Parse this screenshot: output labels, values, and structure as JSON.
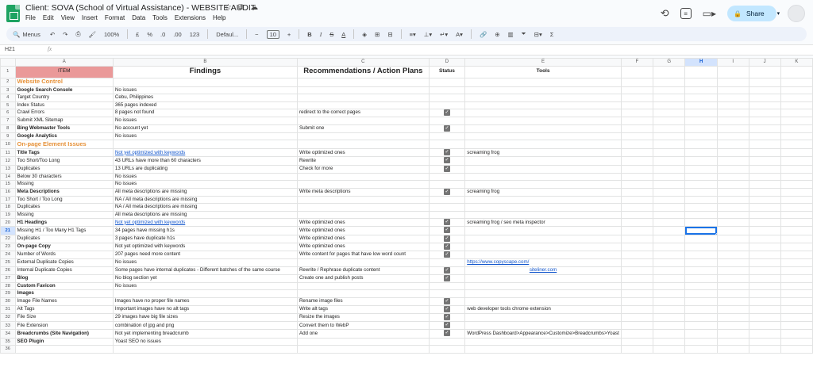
{
  "app": {
    "title": "Client: SOVA (School of Virtual Assistance) - WEBSITE AUDIT",
    "menu": [
      "File",
      "Edit",
      "View",
      "Insert",
      "Format",
      "Data",
      "Tools",
      "Extensions",
      "Help"
    ],
    "share_label": "Share"
  },
  "toolbar": {
    "search_label": "Menus",
    "zoom": "100%",
    "currency": "£",
    "percent": "%",
    "dec_decrease": ".0",
    "dec_increase": ".00",
    "number_format": "123",
    "font": "Defaul...",
    "font_size": "10",
    "bold": "B",
    "italic": "I",
    "strike": "S",
    "text_color": "A",
    "sum": "Σ"
  },
  "formula_bar": {
    "cell_ref": "H21",
    "fx": "fx",
    "value": ""
  },
  "columns": [
    "A",
    "B",
    "C",
    "D",
    "E",
    "F",
    "G",
    "H",
    "I",
    "J",
    "K"
  ],
  "header_row": {
    "item": "ITEM",
    "findings": "Findings",
    "recommendations": "Recommendations / Action Plans",
    "status": "Status",
    "tools": "Tools"
  },
  "rows": [
    {
      "n": "2",
      "item": "Website Control",
      "style": "section"
    },
    {
      "n": "3",
      "item": "Google Search Console",
      "bold": true,
      "findings": "No issues"
    },
    {
      "n": "4",
      "item": "Target Country",
      "findings": "Cebu, Philippines"
    },
    {
      "n": "5",
      "item": "Index Status",
      "findings": "365 pages indexed"
    },
    {
      "n": "6",
      "item": "Crawl Errors",
      "findings": "8 pages not found",
      "rec": "redirect to the correct pages",
      "check": true
    },
    {
      "n": "7",
      "item": "Submit XML Sitemap",
      "findings": "No issues"
    },
    {
      "n": "8",
      "item": "Bing Webmaster Tools",
      "bold": true,
      "findings": "No account yet",
      "rec": "Submit one",
      "check": true
    },
    {
      "n": "9",
      "item": "Google Analytics",
      "bold": true,
      "findings": "No issues"
    },
    {
      "n": "10",
      "item": "On-page Element Issues",
      "style": "section"
    },
    {
      "n": "11",
      "item": "Title Tags",
      "bold": true,
      "findings": "Not yet optimized with keywords",
      "findings_link": true,
      "rec": "Write optimized ones",
      "check": true,
      "tools": "screaming frog"
    },
    {
      "n": "12",
      "item": "Too Short/Too Long",
      "findings": "43 URLs have more than 60 characters",
      "rec": "Rewrite",
      "check": true
    },
    {
      "n": "13",
      "item": "Duplicates",
      "findings": "13 URLs are duplicating",
      "rec": "Check for more",
      "check": true
    },
    {
      "n": "14",
      "item": "Below 30 characters",
      "findings": "No issues"
    },
    {
      "n": "15",
      "item": "Missing",
      "findings": "No issues"
    },
    {
      "n": "16",
      "item": "Meta Descriptions",
      "bold": true,
      "findings": "All meta descriptions are missing",
      "rec": "Write meta descriptions",
      "check": true,
      "tools": "screaming frog"
    },
    {
      "n": "17",
      "item": "Too Short / Too Long",
      "findings": "NA / All meta descriptions are missing"
    },
    {
      "n": "18",
      "item": "Duplicates",
      "findings": "NA / All meta descriptions are missing"
    },
    {
      "n": "19",
      "item": "Missing",
      "findings": "All meta descriptions are missing"
    },
    {
      "n": "20",
      "item": "H1 Headings",
      "bold": true,
      "findings": "Not yet optimized with keywords",
      "findings_link": true,
      "rec": "Write optimized ones",
      "check": true,
      "tools": "screaming frog / seo meta inspector"
    },
    {
      "n": "21",
      "item": "Missing H1 / Too Many H1 Tags",
      "findings": "34 pages have missing h1s",
      "rec": "Write optimized ones",
      "check": true,
      "selected": true
    },
    {
      "n": "22",
      "item": "Duplicates",
      "findings": "3 pages have duplicate h1s",
      "rec": "Write optimized ones",
      "check": true
    },
    {
      "n": "23",
      "item": "On-page Copy",
      "bold": true,
      "findings": "Not yet optimized with keywords",
      "rec": "Write optimized ones",
      "check": true
    },
    {
      "n": "24",
      "item": "Number of Words",
      "findings": "207 pages need more content",
      "rec": "Write content for pages that have low word count",
      "check": true
    },
    {
      "n": "25",
      "item": "External Duplicate Copies",
      "findings": "No issues",
      "tools": "https://www.copyscape.com/",
      "tools_link": true
    },
    {
      "n": "26",
      "item": "Internal Duplicate Copies",
      "findings": "Some pages have internal duplicates - Different batches of the same course",
      "rec": "Rewrite / Rephrase duplicate content",
      "check": true,
      "tools": "siteliner.com",
      "tools_link_center": true
    },
    {
      "n": "27",
      "item": "Blog",
      "bold": true,
      "findings": "No blog section yet",
      "rec": "Create one and publish posts",
      "check": true
    },
    {
      "n": "28",
      "item": "Custom Favicon",
      "bold": true,
      "findings": "No issues"
    },
    {
      "n": "29",
      "item": "Images",
      "bold": true
    },
    {
      "n": "30",
      "item": "Image File Names",
      "findings": "Images have no proper file names",
      "rec": "Rename image files",
      "check": true
    },
    {
      "n": "31",
      "item": "Alt Tags",
      "findings": "Important images have no alt tags",
      "rec": "Write alt tags",
      "check": true,
      "tools": "web developer tools chrome extension"
    },
    {
      "n": "32",
      "item": "File Size",
      "findings": "29 images have big file sizes",
      "rec": "Resize the images",
      "check": true
    },
    {
      "n": "33",
      "item": "File Extension",
      "findings": "combination of jpg and png",
      "rec": "Convert them to WebP",
      "check": true
    },
    {
      "n": "34",
      "item": "Breadcrumbs (Site Navigation)",
      "bold": true,
      "findings": "Not yet implementing breadcrumb",
      "rec": "Add one",
      "check": true,
      "tools": "WordPress Dashboard>Appearance>Customize>Breadcrumbs>Yoast"
    },
    {
      "n": "35",
      "item": "SEO Plugin",
      "bold": true,
      "findings": "Yoast SEO no issues"
    },
    {
      "n": "36"
    }
  ],
  "colors": {
    "header_item_bg": "#ea9999",
    "section_text": "#e69138",
    "link": "#1155cc",
    "selection": "#1a73e8"
  },
  "icons": [
    "sheets-logo-icon",
    "star-icon",
    "move-icon",
    "cloud-status-icon",
    "history-icon",
    "comment-icon",
    "meet-icon",
    "lock-icon"
  ]
}
